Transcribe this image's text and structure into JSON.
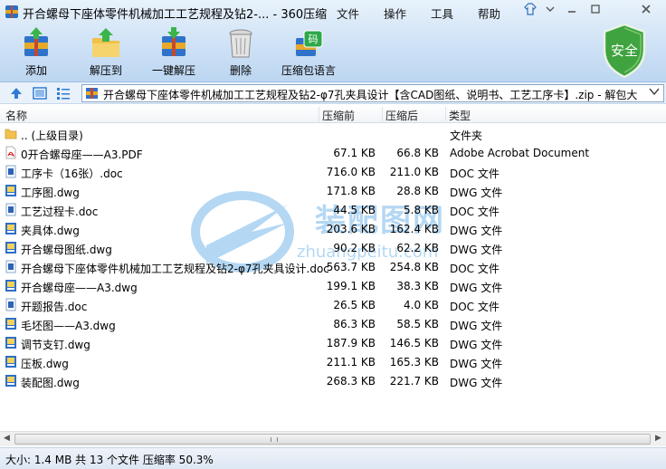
{
  "window": {
    "title": "开合螺母下座体零件机械加工工艺规程及钻2-... - 360压缩"
  },
  "menu": [
    {
      "name": "menu-file",
      "label": "文件"
    },
    {
      "name": "menu-operation",
      "label": "操作"
    },
    {
      "name": "menu-tools",
      "label": "工具"
    },
    {
      "name": "menu-help",
      "label": "帮助"
    }
  ],
  "toolbar": {
    "add_label": "添加",
    "extract_to_label": "解压到",
    "one_click_extract_label": "一键解压",
    "delete_label": "删除",
    "language_label": "压缩包语言",
    "language_badge": "码"
  },
  "security": {
    "label": "安全"
  },
  "address": {
    "path": "开合螺母下座体零件机械加工工艺规程及钻2-φ7孔夹具设计【含CAD图纸、说明书、工艺工序卡】.zip - 解包大小为"
  },
  "columns": {
    "name": "名称",
    "compressed": "压缩前",
    "original": "压缩后",
    "type": "类型"
  },
  "files": [
    {
      "name": ".. (上级目录)",
      "csize": "",
      "osize": "",
      "type": "文件夹",
      "icon": "folder-icon"
    },
    {
      "name": "0开合螺母座——A3.PDF",
      "csize": "67.1 KB",
      "osize": "66.8 KB",
      "type": "Adobe Acrobat Document",
      "icon": "pdf-file-icon"
    },
    {
      "name": "工序卡（16张）.doc",
      "csize": "716.0 KB",
      "osize": "211.0 KB",
      "type": "DOC 文件",
      "icon": "doc-file-icon"
    },
    {
      "name": "工序图.dwg",
      "csize": "171.8 KB",
      "osize": "28.8 KB",
      "type": "DWG 文件",
      "icon": "dwg-file-icon"
    },
    {
      "name": "工艺过程卡.doc",
      "csize": "44.5 KB",
      "osize": "5.8 KB",
      "type": "DOC 文件",
      "icon": "doc-file-icon"
    },
    {
      "name": "夹具体.dwg",
      "csize": "203.6 KB",
      "osize": "162.4 KB",
      "type": "DWG 文件",
      "icon": "dwg-file-icon"
    },
    {
      "name": "开合螺母图纸.dwg",
      "csize": "90.2 KB",
      "osize": "62.2 KB",
      "type": "DWG 文件",
      "icon": "dwg-file-icon"
    },
    {
      "name": "开合螺母下座体零件机械加工工艺规程及钻2-φ7孔夹具设计.doc",
      "csize": "563.7 KB",
      "osize": "254.8 KB",
      "type": "DOC 文件",
      "icon": "doc-file-icon"
    },
    {
      "name": "开合螺母座——A3.dwg",
      "csize": "199.1 KB",
      "osize": "38.3 KB",
      "type": "DWG 文件",
      "icon": "dwg-file-icon"
    },
    {
      "name": "开题报告.doc",
      "csize": "26.5 KB",
      "osize": "4.0 KB",
      "type": "DOC 文件",
      "icon": "doc-file-icon"
    },
    {
      "name": "毛坯图——A3.dwg",
      "csize": "86.3 KB",
      "osize": "58.5 KB",
      "type": "DWG 文件",
      "icon": "dwg-file-icon"
    },
    {
      "name": "调节支钉.dwg",
      "csize": "187.9 KB",
      "osize": "146.5 KB",
      "type": "DWG 文件",
      "icon": "dwg-file-icon"
    },
    {
      "name": "压板.dwg",
      "csize": "211.1 KB",
      "osize": "165.3 KB",
      "type": "DWG 文件",
      "icon": "dwg-file-icon"
    },
    {
      "name": "装配图.dwg",
      "csize": "268.3 KB",
      "osize": "221.7 KB",
      "type": "DWG 文件",
      "icon": "dwg-file-icon"
    }
  ],
  "watermark": {
    "text_cn": "装配图网",
    "url": "zhuangpeitu.com"
  },
  "status": {
    "text": "大小: 1.4 MB 共 13 个文件 压缩率 50.3%"
  },
  "colors": {
    "accent": "#2e7bd6",
    "shield": "#3fa33f"
  }
}
